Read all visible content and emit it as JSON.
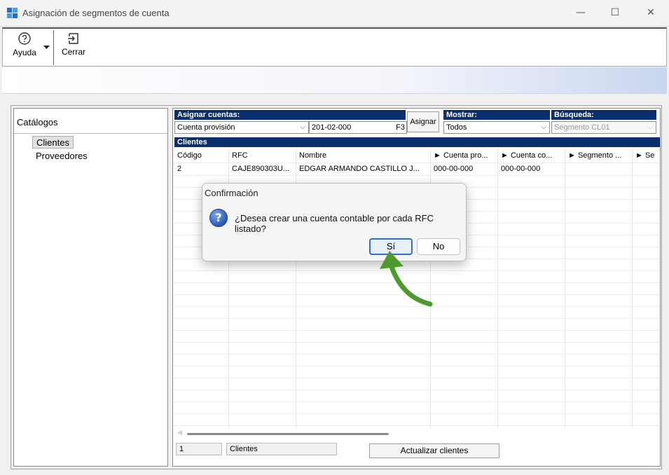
{
  "window": {
    "title": "Asignación de segmentos de cuenta",
    "minimize": "—",
    "maximize": "☐",
    "close": "✕"
  },
  "ribbon": {
    "help_label": "Ayuda",
    "close_label": "Cerrar"
  },
  "catalog": {
    "title": "Catálogos",
    "items": [
      "Clientes",
      "Proveedores"
    ]
  },
  "assign": {
    "header": "Asignar cuentas:",
    "account_type": "Cuenta provisión",
    "account_value": "201-02-000",
    "shortcut": "F3",
    "button_label": "Asignar"
  },
  "show": {
    "header": "Mostrar:",
    "value": "Todos"
  },
  "search": {
    "header": "Búsqueda:",
    "placeholder": "Segmento CL01"
  },
  "grid": {
    "title": "Clientes",
    "columns": [
      "Código",
      "RFC",
      "Nombre",
      "► Cuenta pro...",
      "► Cuenta co...",
      "► Segmento ...",
      "► Se"
    ],
    "rows": [
      {
        "codigo": "2",
        "rfc": "CAJE890303U...",
        "nombre": "EDGAR ARMANDO CASTILLO J...",
        "cuenta_pro": "000-00-000",
        "cuenta_co": "000-00-000",
        "segmento": "",
        "se": ""
      }
    ]
  },
  "status": {
    "count": "1",
    "label": "Clientes",
    "refresh_button": "Actualizar clientes"
  },
  "dialog": {
    "title": "Confirmación",
    "message": "¿Desea crear una cuenta contable por cada RFC listado?",
    "yes": "Sí",
    "no": "No",
    "icon": "question-icon"
  },
  "annotation": {
    "color": "#4f9a2c"
  }
}
